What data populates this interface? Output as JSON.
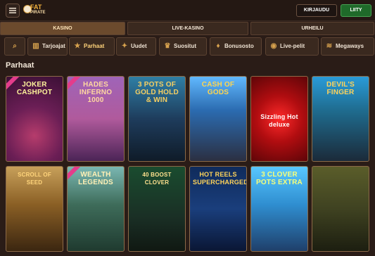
{
  "header": {
    "logo_top": "FAT",
    "logo_bottom": "PIRATE",
    "login_label": "KIRJAUDU",
    "join_label": "LIITY"
  },
  "sections": [
    "KASINO",
    "LIVE-KASINO",
    "URHEILU"
  ],
  "categories": [
    "Tarjoajat",
    "Parhaat",
    "Uudet",
    "Suositut",
    "Bonusosto",
    "Live-pelit",
    "Megaways"
  ],
  "heading": "Parhaat",
  "games": [
    {
      "title": "JOKER CASHPOT"
    },
    {
      "title": "HADES INFERNO 1000"
    },
    {
      "title": "3 POTS OF GOLD HOLD & WIN"
    },
    {
      "title": "CASH OF GODS"
    },
    {
      "title": "Sizzling Hot deluxe"
    },
    {
      "title": "DEVIL'S FINGER"
    },
    {
      "title": "SCROLL OF SEED"
    },
    {
      "title": "WEALTH LEGENDS"
    },
    {
      "title": "40 BOOST CLOVER"
    },
    {
      "title": "HOT REELS SUPERCHARGED"
    },
    {
      "title": "3 CLOVER POTS EXTRA"
    },
    {
      "title": ""
    }
  ],
  "colors": {
    "background": "#2a1c17",
    "accent": "#f2b13d",
    "join": "#1f6a2a"
  }
}
